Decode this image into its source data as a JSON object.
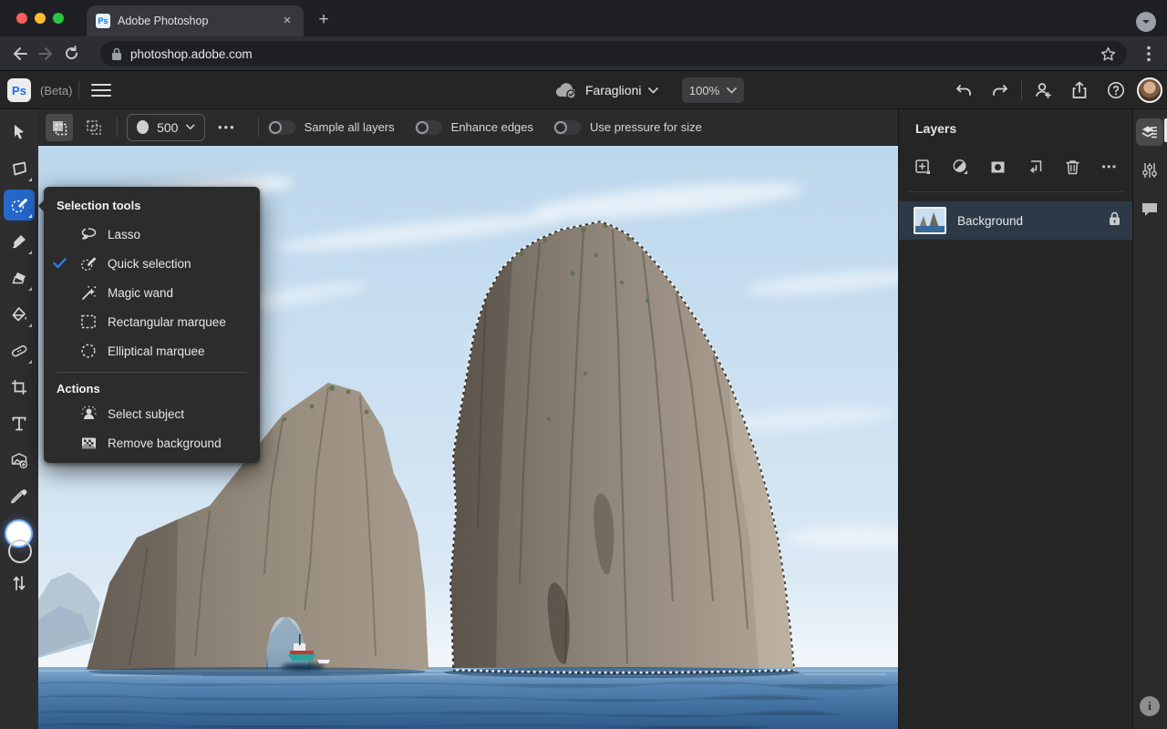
{
  "browser": {
    "tab_title": "Adobe Photoshop",
    "favicon_text": "Ps",
    "close_glyph": "×",
    "new_tab_glyph": "+",
    "url": "photoshop.adobe.com",
    "traffic_lights": {
      "close": "#ff5f57",
      "minimize": "#febc2e",
      "zoom": "#28c840"
    }
  },
  "appbar": {
    "logo_text": "Ps",
    "beta_label": "(Beta)",
    "document_name": "Faraglioni",
    "zoom_value": "100%"
  },
  "options": {
    "brush_size": "500",
    "more_glyph": "•••",
    "toggles": [
      {
        "label": "Sample all layers",
        "on": false
      },
      {
        "label": "Enhance edges",
        "on": false
      },
      {
        "label": "Use pressure for size",
        "on": false
      }
    ]
  },
  "flyout": {
    "title": "Selection tools",
    "items": [
      {
        "label": "Lasso",
        "checked": false
      },
      {
        "label": "Quick selection",
        "checked": true
      },
      {
        "label": "Magic wand",
        "checked": false
      },
      {
        "label": "Rectangular marquee",
        "checked": false
      },
      {
        "label": "Elliptical marquee",
        "checked": false
      }
    ],
    "actions_title": "Actions",
    "actions": [
      {
        "label": "Select subject"
      },
      {
        "label": "Remove background"
      }
    ]
  },
  "layers_panel": {
    "title": "Layers",
    "more_glyph": "•••",
    "rows": [
      {
        "name": "Background",
        "locked": true,
        "selected": true
      }
    ]
  },
  "info_glyph": "i",
  "colors": {
    "accent_blue": "#2667cb",
    "check_blue": "#2f7ae5",
    "selected_row": "#2d3947",
    "panel_bg": "#252526",
    "chrome_bg": "#1f2023"
  }
}
